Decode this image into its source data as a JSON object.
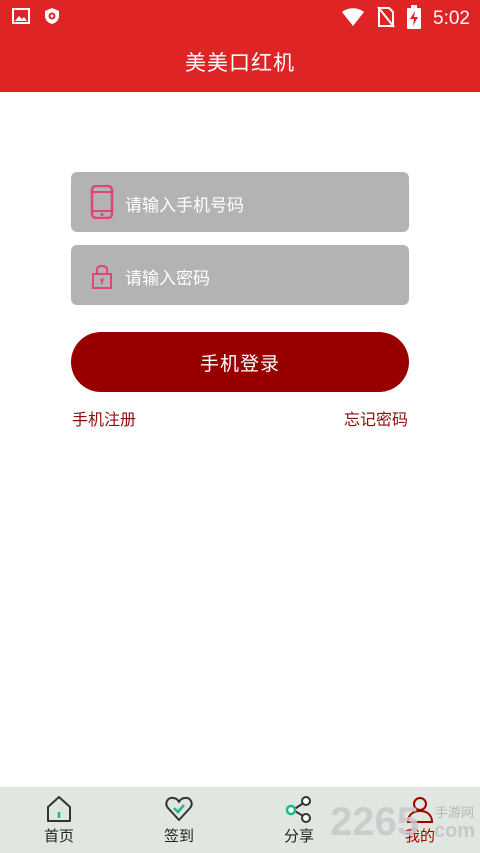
{
  "status_bar": {
    "time": "5:02",
    "icons": [
      "image-notification-icon",
      "shield-notification-icon",
      "wifi-icon",
      "no-sim-icon",
      "battery-charging-icon"
    ]
  },
  "header": {
    "title": "美美口红机",
    "color": "#de2424"
  },
  "login": {
    "phone_placeholder": "请输入手机号码",
    "password_placeholder": "请输入密码",
    "login_button": "手机登录",
    "register_link": "手机注册",
    "forgot_link": "忘记密码",
    "button_color": "#980000",
    "icon_color": "#e0457a"
  },
  "tabbar": {
    "tabs": [
      {
        "label": "首页",
        "icon": "home-icon",
        "active": false
      },
      {
        "label": "签到",
        "icon": "heart-check-icon",
        "active": false
      },
      {
        "label": "分享",
        "icon": "share-icon",
        "active": false
      },
      {
        "label": "我的",
        "icon": "user-icon",
        "active": true
      }
    ],
    "active_color": "#a30000"
  },
  "watermark": {
    "number": "2265",
    "text": "手游网",
    "domain": "com"
  }
}
